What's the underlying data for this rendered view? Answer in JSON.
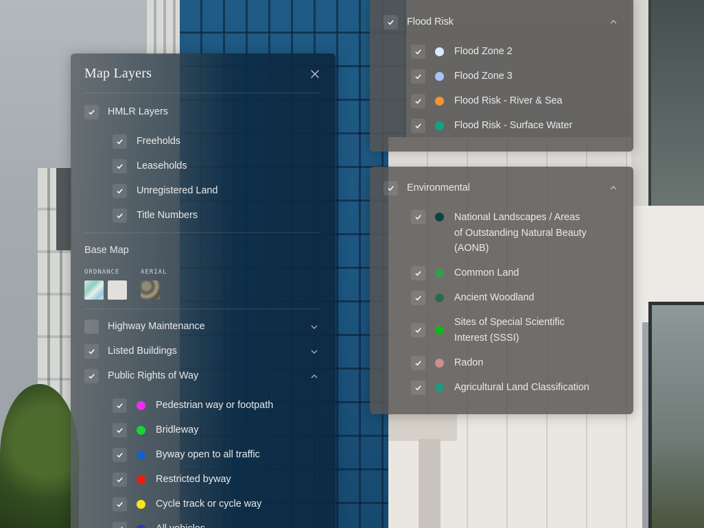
{
  "colors": {
    "pedestrian": "#ee2df0",
    "bridleway": "#19d336",
    "byway": "#1561c4",
    "restricted": "#f01c12",
    "cycle": "#f5e51a",
    "allvehicles": "#2b3bb8",
    "flood_zone_2": "#dde7ff",
    "flood_zone_3": "#a9c3f5",
    "flood_river_sea": "#f79332",
    "flood_surface": "#0fa580",
    "aonb": "#0c4444",
    "common_land": "#32a04a",
    "ancient_woodland": "#2e6a4a",
    "sssi": "#14b51c",
    "radon": "#cc8e90",
    "alc": "#1f9a7e"
  },
  "layers_panel": {
    "title": "Map Layers",
    "close_icon": "close-icon",
    "hmlr": {
      "label": "HMLR Layers",
      "checked": true,
      "items": [
        {
          "label": "Freeholds",
          "checked": true
        },
        {
          "label": "Leaseholds",
          "checked": true
        },
        {
          "label": "Unregistered Land",
          "checked": true
        },
        {
          "label": "Title Numbers",
          "checked": true
        }
      ]
    },
    "base_map": {
      "label": "Base Map",
      "options": [
        {
          "label": "ORDNANCE"
        },
        {
          "label": "AERIAL"
        }
      ]
    },
    "groups": [
      {
        "label": "Highway Maintenance",
        "checked": false,
        "expanded": false
      },
      {
        "label": "Listed Buildings",
        "checked": true,
        "expanded": false
      },
      {
        "label": "Public Rights of Way",
        "checked": true,
        "expanded": true
      }
    ],
    "rights_of_way": [
      {
        "label": "Pedestrian way or footpath",
        "checked": true
      },
      {
        "label": "Bridleway",
        "checked": true
      },
      {
        "label": "Byway open to all traffic",
        "checked": true
      },
      {
        "label": "Restricted byway",
        "checked": true
      },
      {
        "label": "Cycle track or cycle way",
        "checked": true
      },
      {
        "label": "All vehicles",
        "checked": true
      }
    ]
  },
  "flood_panel": {
    "label": "Flood Risk",
    "checked": true,
    "expanded": true,
    "items": [
      {
        "label": "Flood Zone 2",
        "checked": true
      },
      {
        "label": "Flood Zone 3",
        "checked": true
      },
      {
        "label": "Flood Risk - River & Sea",
        "checked": true
      },
      {
        "label": "Flood Risk - Surface Water",
        "checked": true
      }
    ]
  },
  "env_panel": {
    "label": "Environmental",
    "checked": true,
    "expanded": true,
    "items": [
      {
        "label_lines": [
          "National Landscapes / Areas",
          "of Outstanding Natural Beauty",
          "(AONB)"
        ],
        "checked": true
      },
      {
        "label": "Common Land",
        "checked": true
      },
      {
        "label": "Ancient Woodland",
        "checked": true
      },
      {
        "label_lines": [
          "Sites of Special Scientific",
          "Interest (SSSI)"
        ],
        "checked": true
      },
      {
        "label": "Radon",
        "checked": true
      },
      {
        "label": "Agricultural Land Classification",
        "checked": true
      }
    ]
  }
}
